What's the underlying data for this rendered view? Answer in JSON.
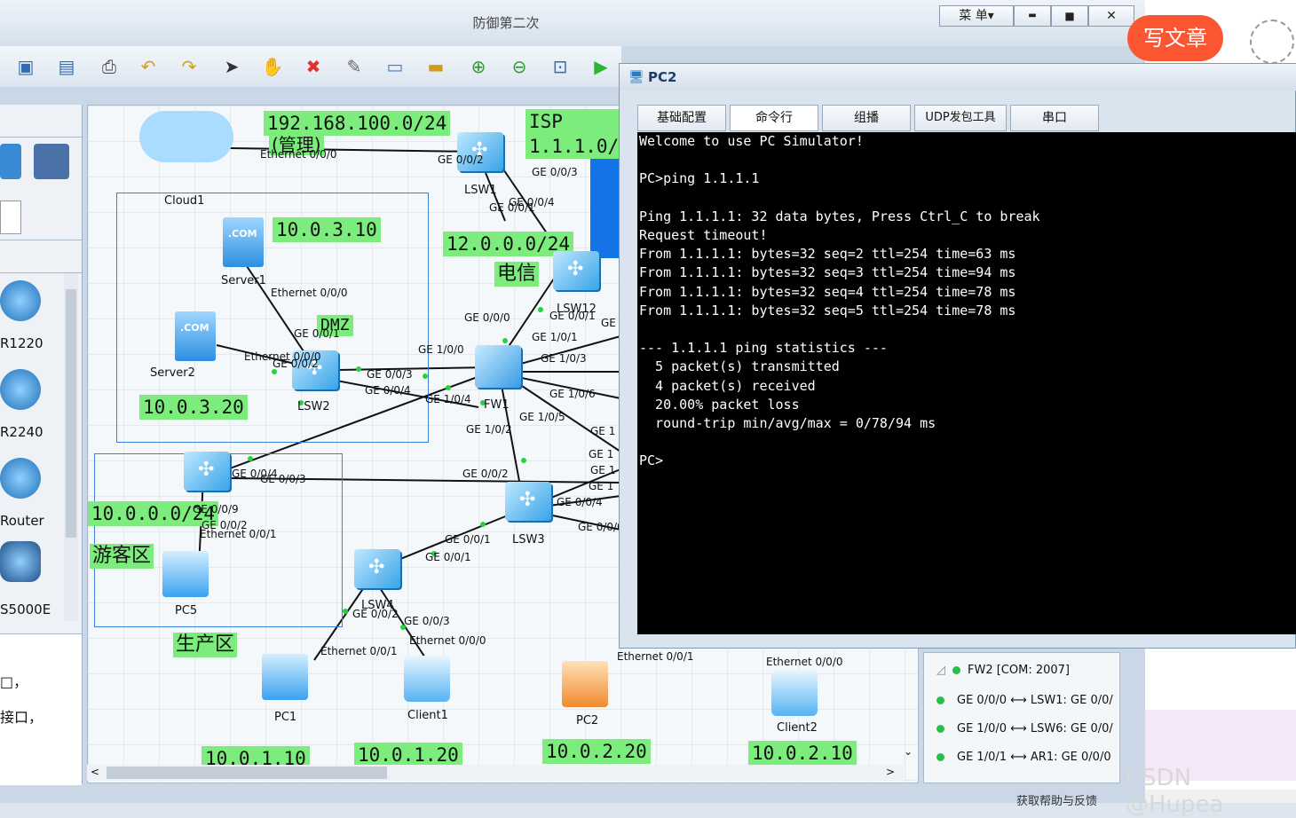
{
  "window": {
    "title": "防御第二次",
    "menu_label": "菜 单▾",
    "minimize": "▬",
    "maximize": "■",
    "close": "✕"
  },
  "palette": {
    "items": [
      "R1220",
      "R2240",
      "Router",
      "S5000E"
    ],
    "notes": [
      "□，",
      "接口，"
    ]
  },
  "topology": {
    "zones": {
      "mgmt": "192.168.100.0/24",
      "mgmt_cn": "(管理)",
      "isp": "ISP",
      "isp_ip": "1.1.1.0/",
      "dx_net": "12.0.0.0/24",
      "dx": "电信",
      "dmz": "DMZ",
      "guest_net": "10.0.0.0/24",
      "guest": "游客区",
      "prod": "生产区"
    },
    "devices": {
      "cloud1": "Cloud1",
      "server1": "Server1",
      "server2": "Server2",
      "lsw1": "LSW1",
      "lsw2": "LSW2",
      "lsw3": "LSW3",
      "lsw4": "LSW4",
      "lsw12": "LSW12",
      "fw1": "FW1",
      "pc1": "PC1",
      "pc2": "PC2",
      "pc5": "PC5",
      "client1": "Client1",
      "client2": "Client2"
    },
    "ips": {
      "server1": "10.0.3.10",
      "server2": "10.0.3.20",
      "pc1": "10.0.1.10",
      "client1": "10.0.1.20",
      "pc2": "10.0.2.20",
      "client2": "10.0.2.10"
    },
    "ports": {
      "p1": "Ethernet 0/0/0",
      "p2": "GE 0/0/2",
      "p3": "GE 0/0/3",
      "p4": "GE 0/0/4",
      "p5": "GE 0/0/1",
      "p6": "Ethernet 0/0/0",
      "p7": "GE 0/0/1",
      "p8": "Ethernet 0/0/0",
      "p9": "GE 0/0/2",
      "p10": "GE 0/0/3",
      "p11": "GE 0/0/4",
      "p12": "GE 0/0/0",
      "p13": "GE 0/0/1",
      "p14": "GE 1/0/0",
      "p15": "GE 1/0/1",
      "p16": "GE 1/0/3",
      "p17": "GE 1/0/4",
      "p18": "GE 1/0/6",
      "p19": "GE 1/0/5",
      "p20": "GE 1/0/2",
      "p21": "GE 0/0/4",
      "p22": "GE 0/0/3",
      "p23": "GE 0/0/2",
      "p24": "GE 0/0/4",
      "p25": "GE 0/0/1",
      "p26": "GE 0/0/1",
      "p27": "GE 0/0/2",
      "p28": "Ethernet 0/0/1",
      "p29": "GE 0/0/3",
      "p30": "Ethernet 0/0/0",
      "p31": "Ethernet 0/0/1",
      "p32": "GE 0/0/9",
      "p33": "Ethernet 0/0/1",
      "p34": "Ethernet 0/0/0",
      "p35": "GE 0/0/2",
      "p36": "GE 0/0/0",
      "p37": "GE 1",
      "p38": "GE 1",
      "p39": "GE 1",
      "p40": "GE 1",
      "p41": "GE"
    }
  },
  "pc2": {
    "title": "PC2",
    "tabs": [
      "基础配置",
      "命令行",
      "组播",
      "UDP发包工具",
      "串口"
    ],
    "terminal": [
      "Welcome to use PC Simulator!",
      "",
      "PC>ping 1.1.1.1",
      "",
      "Ping 1.1.1.1: 32 data bytes, Press Ctrl_C to break",
      "Request timeout!",
      "From 1.1.1.1: bytes=32 seq=2 ttl=254 time=63 ms",
      "From 1.1.1.1: bytes=32 seq=3 ttl=254 time=94 ms",
      "From 1.1.1.1: bytes=32 seq=4 ttl=254 time=78 ms",
      "From 1.1.1.1: bytes=32 seq=5 ttl=254 time=78 ms",
      "",
      "--- 1.1.1.1 ping statistics ---",
      "  5 packet(s) transmitted",
      "  4 packet(s) received",
      "  20.00% packet loss",
      "  round-trip min/avg/max = 0/78/94 ms",
      "",
      "PC>"
    ]
  },
  "links": {
    "header": "FW2 [COM: 2007]",
    "items": [
      "GE 0/0/0 ⟷ LSW1: GE 0/0/",
      "GE 1/0/0 ⟷ LSW6: GE 0/0/",
      "GE 1/0/1 ⟷ AR1: GE 0/0/0"
    ]
  },
  "csdn": {
    "article": "写文章",
    "watermark": "CSDN @Hupea",
    "footer": "获取帮助与反馈"
  },
  "colors": {
    "zone_green": "#7cec7c",
    "accent": "#fc5531"
  }
}
